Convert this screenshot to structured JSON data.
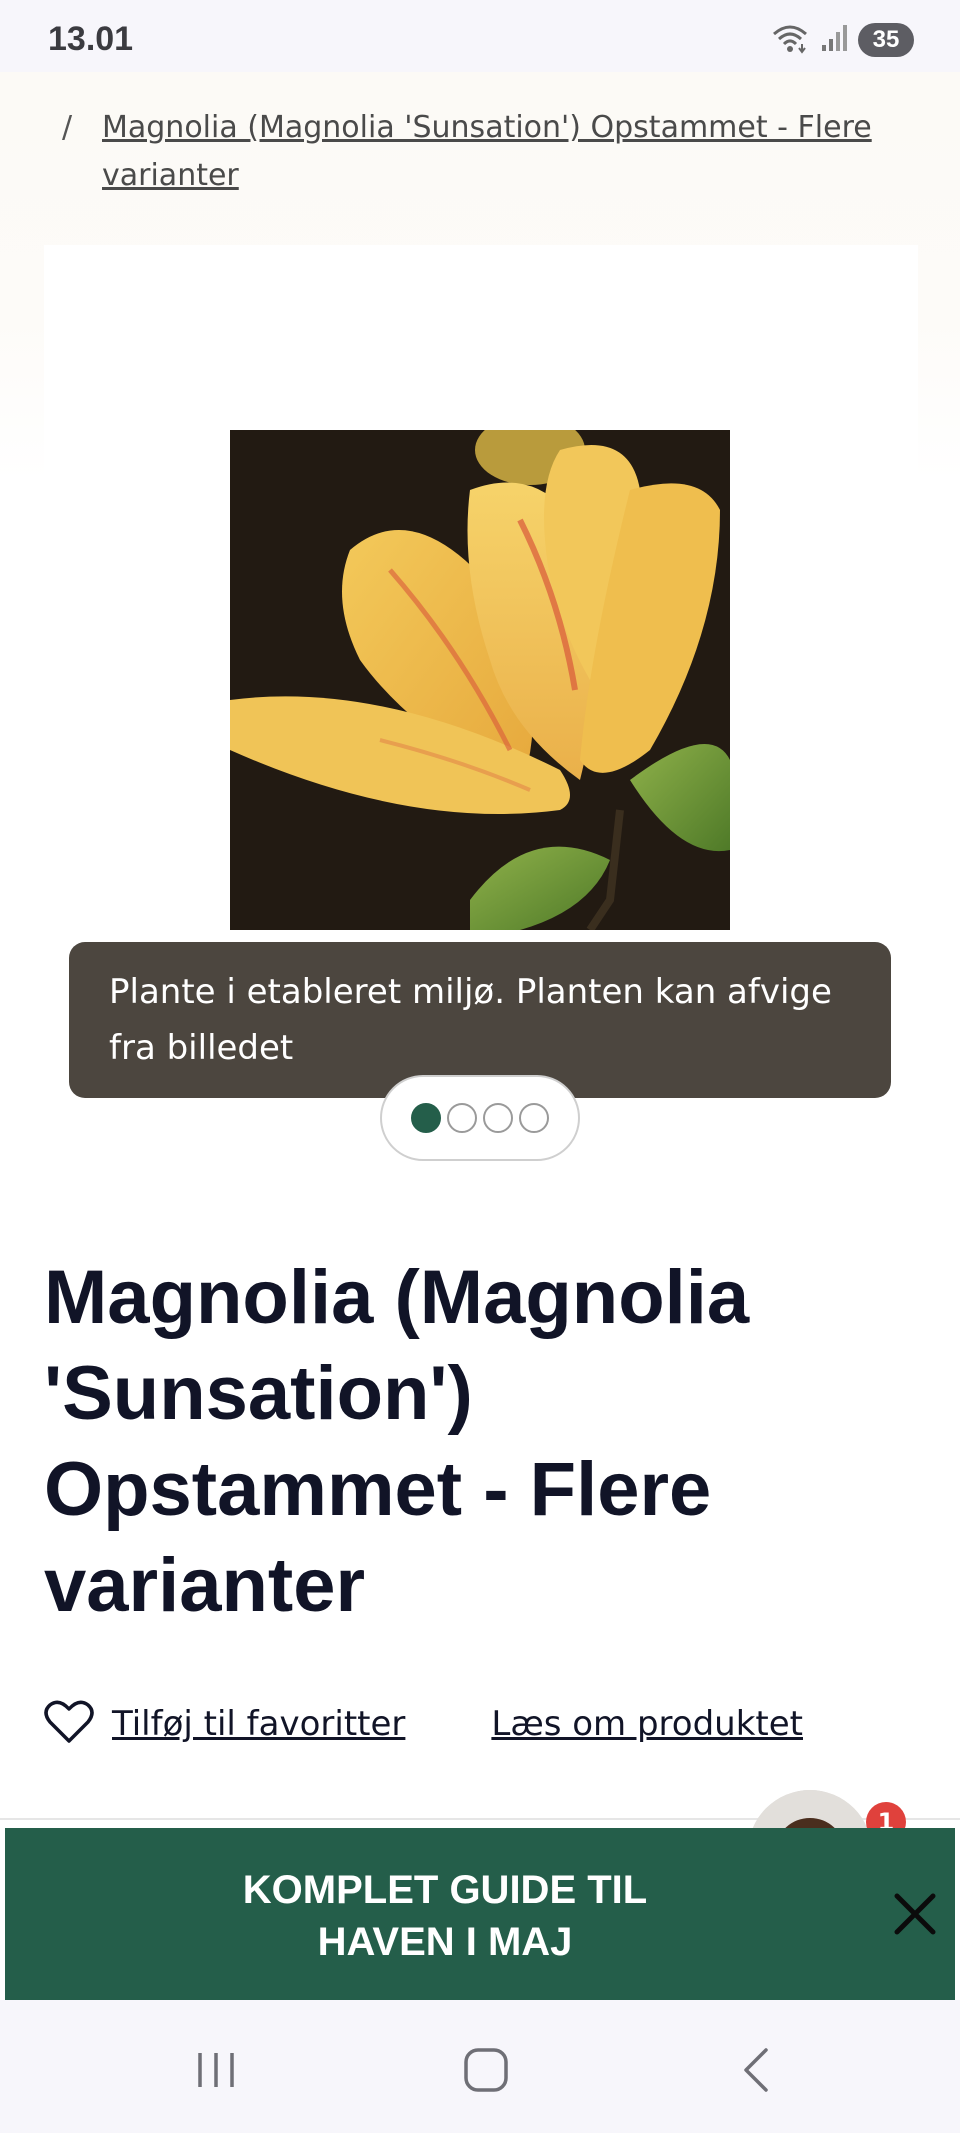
{
  "status_bar": {
    "time": "13.01",
    "battery": "35"
  },
  "breadcrumb": {
    "separator": "/",
    "current": "Magnolia (Magnolia 'Sunsation') Opstammet - Flere varianter"
  },
  "gallery": {
    "caption": "Plante i etableret miljø. Planten kan afvige fra billedet",
    "slide_count": 4,
    "active_slide": 1
  },
  "product": {
    "title": "Magnolia (Magnolia 'Sunsation') Opstammet - Flere varianter",
    "favorite_label": "Tilføj til favoritter",
    "read_more_label": "Læs om produktet"
  },
  "chat": {
    "badge_count": "1"
  },
  "promo": {
    "text_line1": "KOMPLET GUIDE TIL",
    "text_line2": "HAVEN I MAJ"
  },
  "colors": {
    "brand_green": "#245e4a",
    "caption_bg": "#4c463f",
    "badge_red": "#e0413c"
  }
}
